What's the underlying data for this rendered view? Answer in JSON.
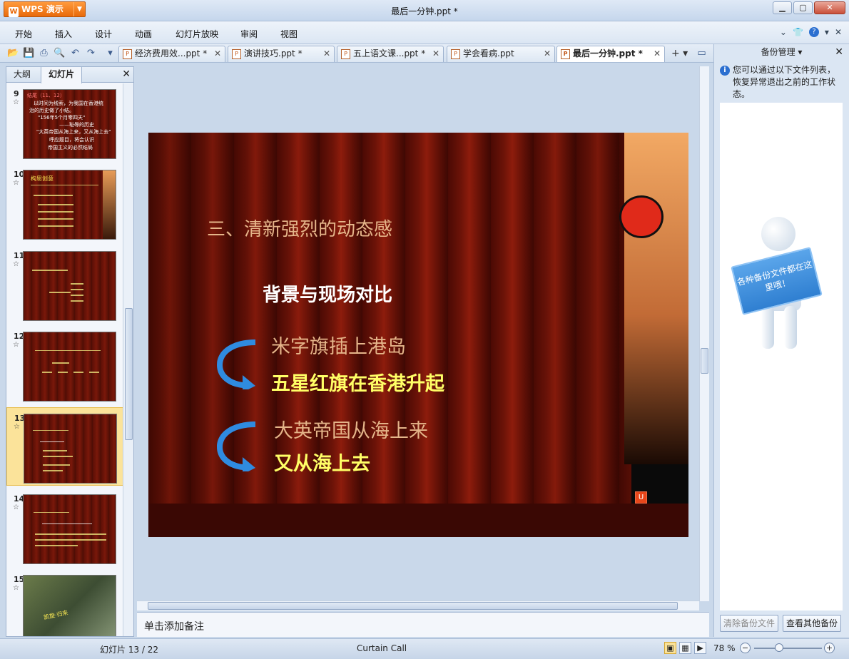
{
  "app": {
    "name": "WPS 演示",
    "document_title": "最后一分钟.ppt *"
  },
  "menu": [
    "开始",
    "插入",
    "设计",
    "动画",
    "幻灯片放映",
    "审阅",
    "视图"
  ],
  "doc_tabs": [
    {
      "label": "经济费用效...ppt *",
      "active": false
    },
    {
      "label": "演讲技巧.ppt *",
      "active": false
    },
    {
      "label": "五上语文课...ppt *",
      "active": false
    },
    {
      "label": "学会看病.ppt",
      "active": false
    },
    {
      "label": "最后一分钟.ppt *",
      "active": true
    }
  ],
  "left_pane": {
    "tabs": [
      "大纲",
      "幻灯片"
    ],
    "active_tab": "幻灯片",
    "slides": [
      {
        "num": "9"
      },
      {
        "num": "10"
      },
      {
        "num": "11"
      },
      {
        "num": "12"
      },
      {
        "num": "13",
        "selected": true
      },
      {
        "num": "14"
      },
      {
        "num": "15"
      }
    ],
    "slide9_lines": [
      "结尾（11、12）",
      "以时间为线索，为我国在香港统",
      "治的历史做了小结。",
      "\"156年5个月零四天\"",
      "——耻辱的历史",
      "\"大英帝国从海上来，又从海上去\"",
      "呼应题目，将会认识",
      "帝国主义的必然结局"
    ],
    "slide10_title": "构思创意",
    "slide15_caption": "凯旋·归来"
  },
  "slide": {
    "title": "三、清新强烈的动态感",
    "subtitle": "背景与现场对比",
    "pair1_a": "米字旗插上港岛",
    "pair1_b": "五星红旗在香港升起",
    "pair2_a": "大英帝国从海上来",
    "pair2_b": "又从海上去"
  },
  "notes_placeholder": "单击添加备注",
  "backup_pane": {
    "title": "备份管理",
    "info": "您可以通过以下文件列表，恢复异常退出之前的工作状态。",
    "sign_text": "各种备份文件都在这里哦！",
    "btn_clear": "清除备份文件",
    "btn_view": "查看其他备份"
  },
  "status": {
    "slide_pos": "幻灯片 13 / 22",
    "theme": "Curtain Call",
    "zoom": "78 %"
  },
  "colors": {
    "accent_orange": "#e86a0b",
    "slide_yellow": "#ffff66",
    "slide_tan": "#e5b58a",
    "arrow_blue": "#2f8be0"
  }
}
